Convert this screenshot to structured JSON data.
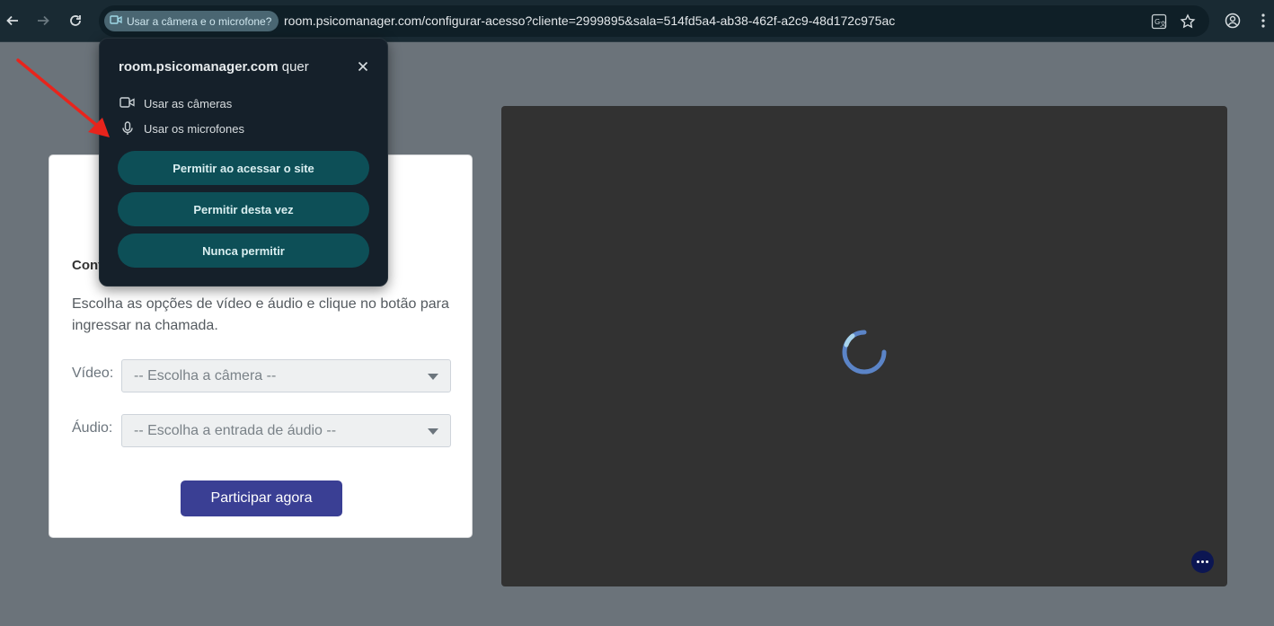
{
  "browser": {
    "permission_chip": "Usar a câmera e o microfone?",
    "url": "room.psicomanager.com/configurar-acesso?cliente=2999895&sala=514fd5a4-ab38-462f-a2c9-48d172c975ac"
  },
  "popup": {
    "site": "room.psicomanager.com",
    "wants": "quer",
    "permissions": [
      "Usar as câmeras",
      "Usar os microfones"
    ],
    "buttons": {
      "allow_always": "Permitir ao acessar o site",
      "allow_once": "Permitir desta vez",
      "never": "Nunca permitir"
    }
  },
  "card": {
    "heading_partial": "Cont",
    "description": "Escolha as opções de vídeo e áudio e clique no botão para ingressar na chamada.",
    "video_label": "Vídeo:",
    "video_placeholder": "-- Escolha a câmera --",
    "audio_label": "Áudio:",
    "audio_placeholder": "-- Escolha a entrada de áudio --",
    "join_button": "Participar agora"
  },
  "colors": {
    "page_bg": "#6b737a",
    "toolbar_bg": "#192a33",
    "popup_button": "#0d4f57",
    "join_button": "#3a3f94",
    "video_bg": "#323232",
    "arrow": "#e8241c"
  }
}
